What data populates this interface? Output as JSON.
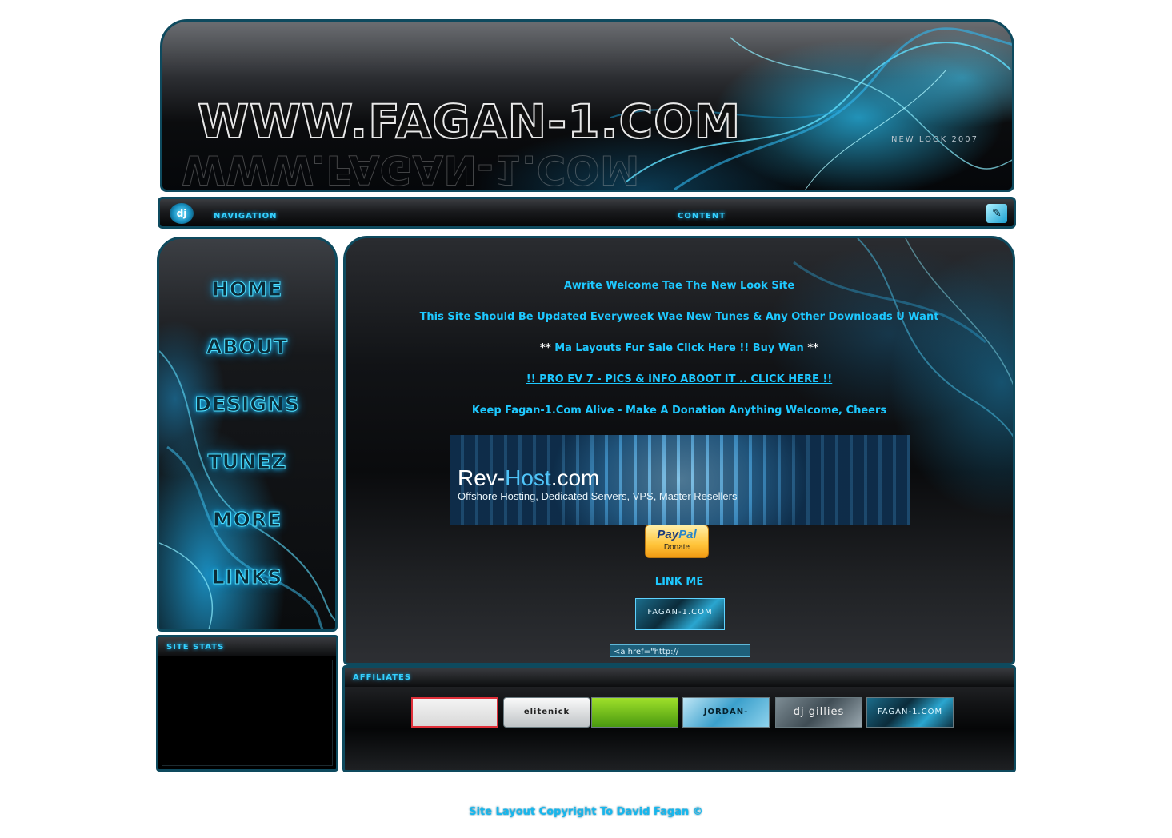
{
  "header": {
    "logo_text": "WWW.FAGAN-1.COM",
    "tagline": "New Look 2007"
  },
  "bar": {
    "navigation_label": "Navigation",
    "content_label": "Content"
  },
  "nav": {
    "items": [
      {
        "label": "HOME"
      },
      {
        "label": "ABOUT"
      },
      {
        "label": "DESIGNS"
      },
      {
        "label": "TUNEZ"
      },
      {
        "label": "MORE"
      },
      {
        "label": "LINKS"
      }
    ]
  },
  "stats": {
    "title": "Site Stats"
  },
  "content": {
    "welcome": "Awrite Welcome Tae The New Look Site",
    "update_note": "This Site Should Be Updated Everyweek Wae New Tunes & Any Other Downloads U Want",
    "layouts_prefix": "**",
    "layouts_link": "Ma Layouts Fur Sale Click Here !! Buy Wan",
    "layouts_suffix": "**",
    "pro_ev_link": "!! PRO EV 7 - PICS & INFO ABOOT IT .. CLICK HERE !!",
    "donation_note": "Keep Fagan-1.Com Alive - Make A Donation Anything Welcome, Cheers",
    "revhost": {
      "name_part1": "Rev-",
      "name_part2": "Host",
      "name_part3": ".com",
      "subtitle": "Offshore Hosting, Dedicated Servers, VPS, Master Resellers"
    },
    "paypal": {
      "brand_part1": "Pay",
      "brand_part2": "Pal",
      "action": "Donate"
    },
    "link_me_title": "LINK ME",
    "link_me_banner": "FAGAN-1.COM",
    "textbox_value": "<a href=\"http://"
  },
  "affiliates": {
    "title": "Affiliates",
    "items": [
      {
        "label": ""
      },
      {
        "label": "elitenick"
      },
      {
        "label": ""
      },
      {
        "label": "JORDAN-D.CO.UK"
      },
      {
        "label": "dj gillies"
      },
      {
        "label": "FAGAN-1.COM"
      }
    ]
  },
  "footer": {
    "copyright": "Site Layout Copyright To David Fagan ©"
  },
  "colors": {
    "accent": "#1ec8ff",
    "border": "#0e4a5e",
    "background": "#ffffff"
  }
}
